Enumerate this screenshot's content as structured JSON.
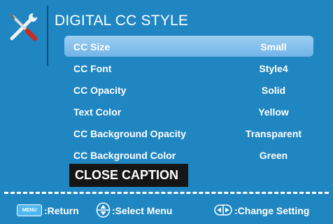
{
  "menu": {
    "title": "DIGITAL CC STYLE",
    "icon": "wrench-screwdriver-icon",
    "items": [
      {
        "label": "CC Size",
        "value": "Small",
        "selected": true
      },
      {
        "label": "CC Font",
        "value": "Style4",
        "selected": false
      },
      {
        "label": "CC Opacity",
        "value": "Solid",
        "selected": false
      },
      {
        "label": "Text Color",
        "value": "Yellow",
        "selected": false
      },
      {
        "label": "CC Background Opacity",
        "value": "Transparent",
        "selected": false
      },
      {
        "label": "CC Background Color",
        "value": "Green",
        "selected": false
      }
    ],
    "close_caption": "CLOSE CAPTION"
  },
  "footer": {
    "menu_key_label": "MENU",
    "return_text": ":Return",
    "select_text": ":Select Menu",
    "change_text": ":Change Setting"
  },
  "colors": {
    "background": "#1f86c2",
    "selected_row": "#87c2ed",
    "close_caption_bg": "#151515",
    "menu_key": "#4fb7ef"
  }
}
